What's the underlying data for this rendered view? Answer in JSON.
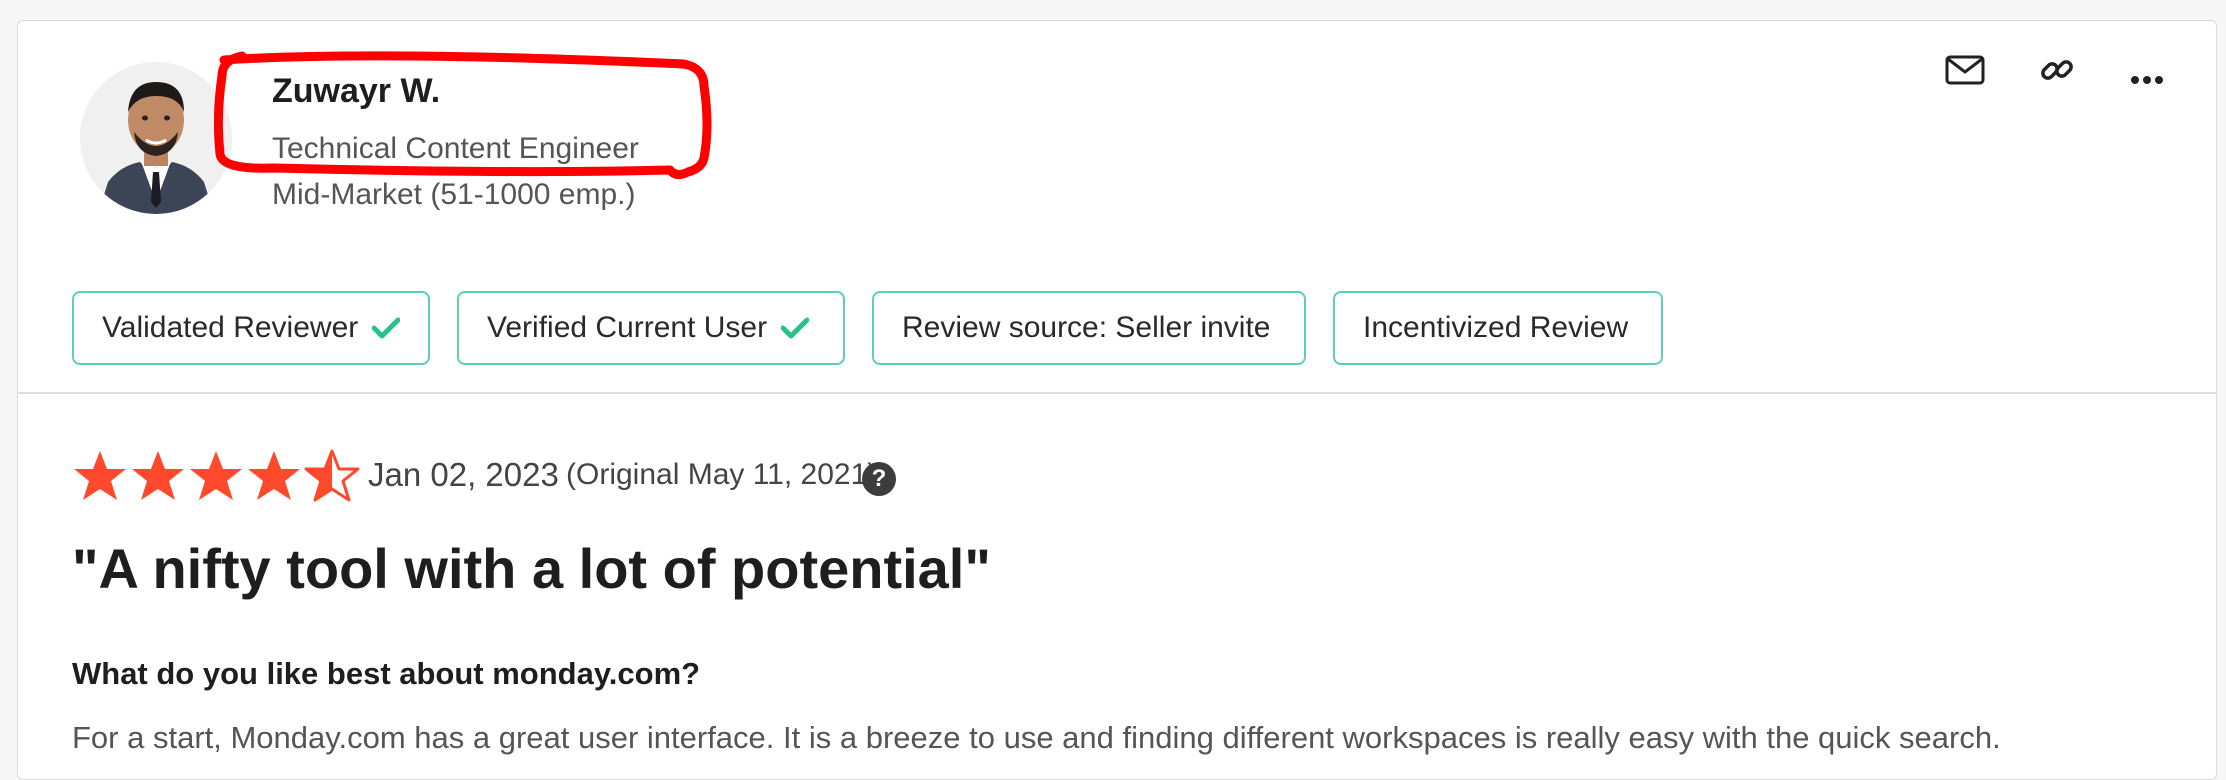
{
  "reviewer": {
    "name": "Zuwayr W.",
    "job_title": "Technical Content Engineer",
    "company_segment": "Mid-Market (51-1000 emp.)"
  },
  "actions": [
    {
      "icon": "mail-icon"
    },
    {
      "icon": "link-icon"
    },
    {
      "icon": "more-icon"
    }
  ],
  "badges": [
    {
      "label": "Validated Reviewer",
      "check": true
    },
    {
      "label": "Verified Current User",
      "check": true
    },
    {
      "label": "Review source: Seller invite",
      "check": false
    },
    {
      "label": "Incentivized Review",
      "check": false
    }
  ],
  "review": {
    "rating": 4.5,
    "rating_max": 5,
    "date": "Jan 02, 2023",
    "original_date": "(Original May 11, 2021)",
    "help_glyph": "?",
    "headline": "\"A nifty tool with a lot of potential\"",
    "question": "What do you like best about monday.com?",
    "answer": "For a start, Monday.com has a great user interface. It is a breeze to use and finding different workspaces is really easy with the quick search."
  },
  "colors": {
    "star": "#ff492c",
    "badge_border": "#5bd0b4",
    "check": "#27c28a",
    "annotation": "#ff0000"
  }
}
